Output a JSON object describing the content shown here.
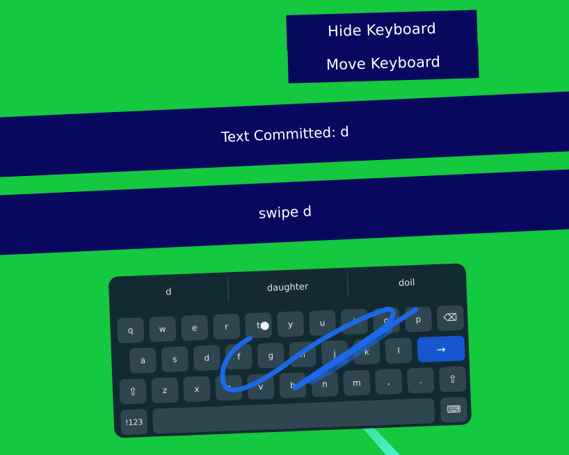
{
  "controls": {
    "hide_keyboard": "Hide Keyboard",
    "move_keyboard": "Move Keyboard"
  },
  "status": {
    "committed": "Text Committed: d",
    "swipe": "swipe d"
  },
  "keyboard": {
    "suggestions": [
      "d",
      "daughter",
      "doil"
    ],
    "row1": [
      "q",
      "w",
      "e",
      "r",
      "t",
      "y",
      "u",
      "i",
      "o",
      "p"
    ],
    "row2": [
      "a",
      "s",
      "d",
      "f",
      "g",
      "h",
      "j",
      "k",
      "l"
    ],
    "row3": [
      "z",
      "x",
      "c",
      "v",
      "b",
      "n",
      "m",
      ",",
      "."
    ],
    "symbols_label": "!123",
    "enter_glyph": "→",
    "backspace_glyph": "⌫",
    "shift_glyph": "⇧",
    "hide_glyph": "⌨"
  },
  "colors": {
    "background": "#14c840",
    "panel": "#07085e",
    "keyboard_bg": "#142a33",
    "key_bg": "#2f4650",
    "enter_key": "#1557d0",
    "swipe_trail": "#1a6cf0",
    "pointer_beam": "#4ff5d8"
  }
}
